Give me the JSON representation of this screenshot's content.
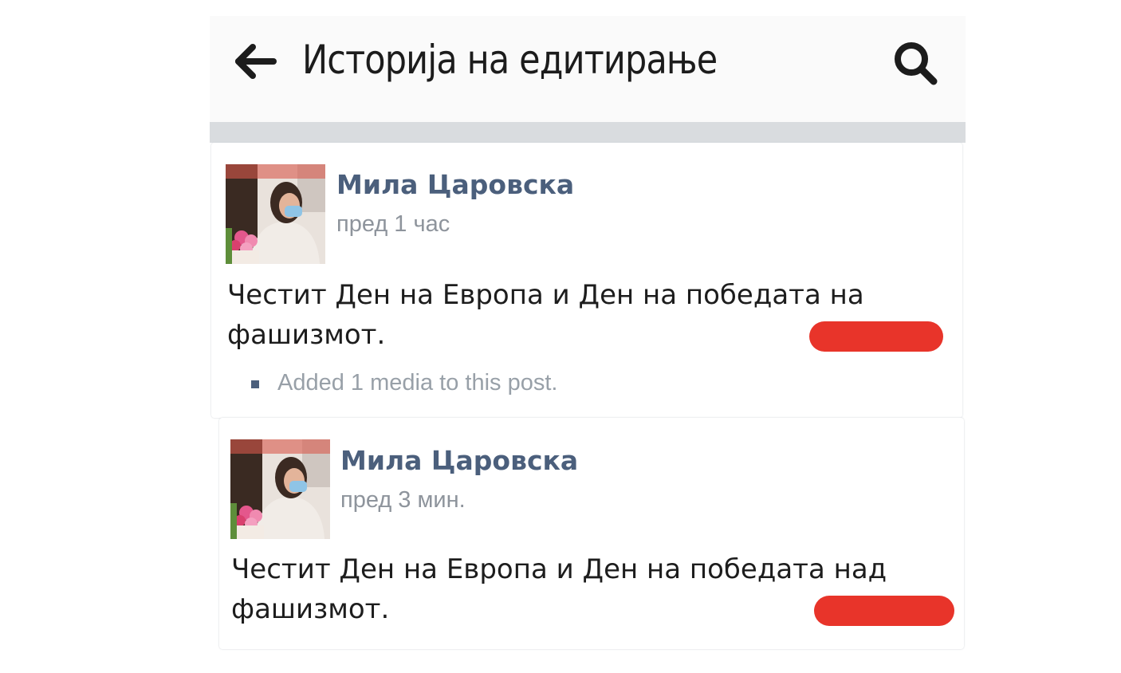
{
  "header": {
    "title": "Историја на едитирање",
    "back_icon": "arrow-left-icon",
    "search_icon": "search-icon"
  },
  "revisions": [
    {
      "author": "Мила Царовска",
      "time": "пред 1 час",
      "text_line1": "Честит Ден на Европа и Ден на победата на",
      "text_line2": "фашизмот.",
      "note": "Added 1 media to this post."
    },
    {
      "author": "Мила Царовска",
      "time": "пред 3 мин.",
      "text_line1": "Честит Ден на Европа и Ден на победата над",
      "text_line2": "фашизмот."
    }
  ],
  "colors": {
    "name": "#4b5f7c",
    "time": "#8e949c",
    "redaction": "#e8342a",
    "divider": "#d9dcdf"
  }
}
